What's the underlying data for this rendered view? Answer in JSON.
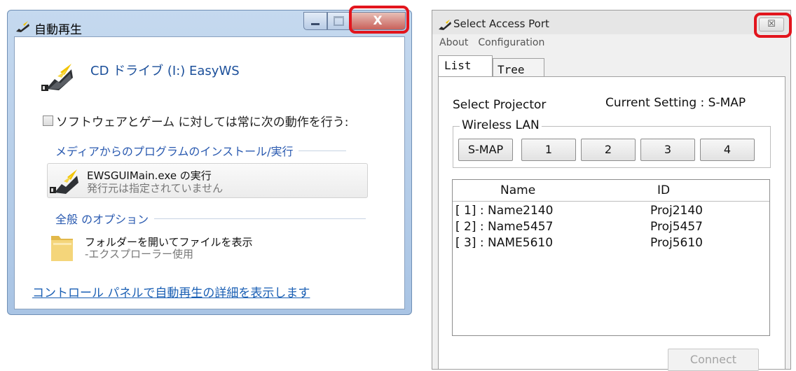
{
  "autoplay": {
    "title": "自動再生",
    "controls": {
      "minimize_icon": "minimize-icon",
      "maximize_icon": "maximize-icon",
      "close_glyph": "X"
    },
    "drive_label": "CD ドライブ (I:) EasyWS",
    "always_checkbox_label": "ソフトウェアとゲーム に対しては常に次の動作を行う:",
    "always_checked": false,
    "media_group": "メディアからのプログラムのインストール/実行",
    "run_option": {
      "line1": "EWSGUIMain.exe の実行",
      "line2": "発行元は指定されていません"
    },
    "general_group": "全般 のオプション",
    "folder_option": {
      "line1": "フォルダーを開いてファイルを表示",
      "line2": "-エクスプローラー使用"
    },
    "control_panel_link": "コントロール パネルで自動再生の詳細を表示します"
  },
  "access_port": {
    "title": "Select Access Port",
    "close_glyph": "☒",
    "menu": [
      "About",
      "Configuration"
    ],
    "tabs": {
      "list": "List",
      "tree": "Tree",
      "active": "List"
    },
    "select_projector": "Select Projector",
    "current_setting": "Current Setting : S-MAP",
    "wireless_group": "Wireless LAN",
    "wireless_buttons": [
      "S-MAP",
      "1",
      "2",
      "3",
      "4"
    ],
    "list": {
      "headers": {
        "name": "Name",
        "id": "ID"
      },
      "rows": [
        {
          "name": "[ 1] : Name2140",
          "id": "Proj2140"
        },
        {
          "name": "[ 2] : Name5457",
          "id": "Proj5457"
        },
        {
          "name": "[ 3] : NAME5610",
          "id": "Proj5610"
        }
      ]
    },
    "connect_button": "Connect",
    "connect_enabled": false
  },
  "colors": {
    "highlight": "#e2151d",
    "link": "#1a5fb4",
    "group_heading": "#2a5ab0",
    "win7_close": "#c9615a"
  }
}
